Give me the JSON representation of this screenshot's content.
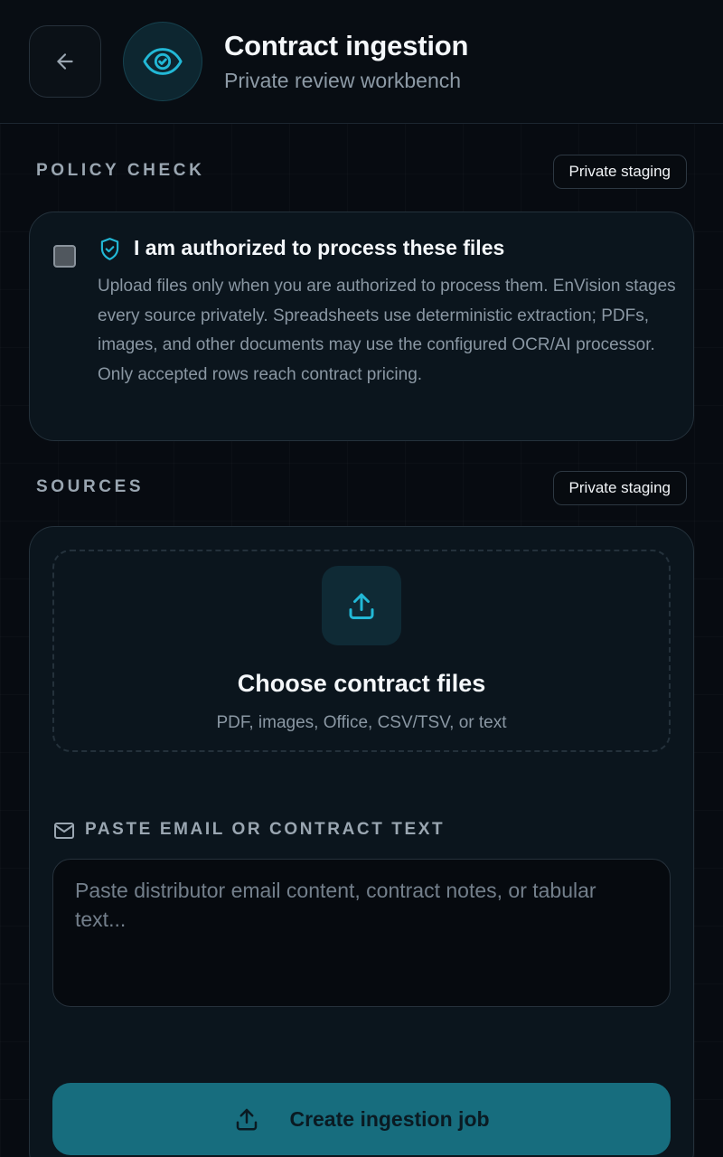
{
  "header": {
    "title": "Contract ingestion",
    "subtitle": "Private review workbench",
    "back_icon": "arrow-left-icon",
    "badge_icon": "eye-check-icon"
  },
  "policy": {
    "section_label": "POLICY CHECK",
    "pill": "Private staging",
    "checkbox_checked": false,
    "title": "I am authorized to process these files",
    "description": "Upload files only when you are authorized to process them. EnVision stages every source privately. Spreadsheets use deterministic extraction; PDFs, images, and other documents may use the configured OCR/AI processor. Only accepted rows reach contract pricing."
  },
  "sources": {
    "section_label": "SOURCES",
    "pill": "Private staging",
    "dropzone_title": "Choose contract files",
    "dropzone_subtitle": "PDF, images, Office, CSV/TSV, or text",
    "paste_label": "PASTE EMAIL OR CONTRACT TEXT",
    "paste_value": "",
    "paste_placeholder": "Paste distributor email content, contract notes, or tabular text...",
    "create_button": "Create ingestion job"
  },
  "colors": {
    "background": "#070b11",
    "accent": "#22b8d6",
    "card": "#0b151d",
    "primary_button": "#176d7e"
  }
}
